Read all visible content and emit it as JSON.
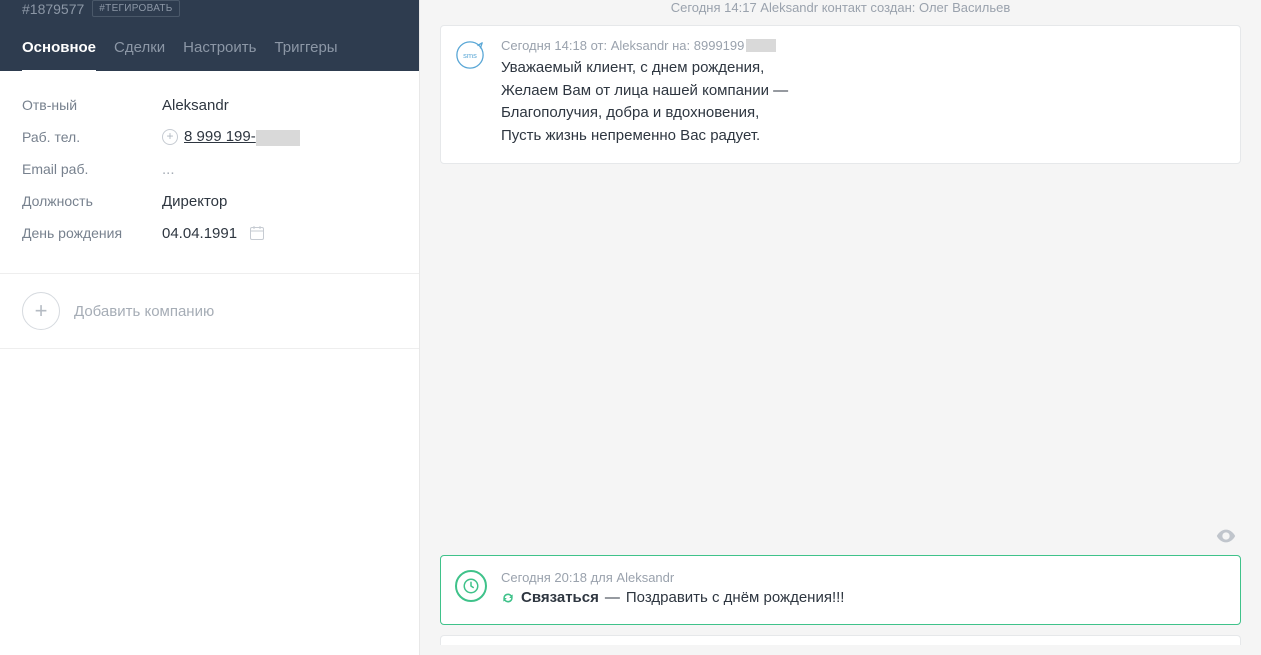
{
  "sidebar": {
    "contact_id": "#1879577",
    "tag_button": "#ТЕГИРОВАТЬ",
    "tabs": [
      "Основное",
      "Сделки",
      "Настроить",
      "Триггеры"
    ],
    "fields": {
      "responsible": {
        "label": "Отв-ный",
        "value": "Aleksandr"
      },
      "phone": {
        "label": "Раб. тел.",
        "value": "8 999 199-"
      },
      "email": {
        "label": "Email раб.",
        "value": "..."
      },
      "position": {
        "label": "Должность",
        "value": "Директор"
      },
      "birthday": {
        "label": "День рождения",
        "value": "04.04.1991"
      }
    },
    "add_company": "Добавить компанию"
  },
  "main": {
    "crumb": "Сегодня 14:17  Aleksandr  контакт создан: Олег Васильев",
    "sms": {
      "meta": "Сегодня 14:18 от: Aleksandr на: 8999199",
      "lines": [
        "Уважаемый клиент, с днем рождения,",
        "Желаем Вам от лица нашей компании —",
        "Благополучия, добра и вдохновения,",
        "Пусть жизнь непременно Вас радует."
      ]
    },
    "task": {
      "meta": "Сегодня 20:18 для Aleksandr",
      "type": "Связаться",
      "text": "Поздравить с днём рождения!!!"
    }
  }
}
